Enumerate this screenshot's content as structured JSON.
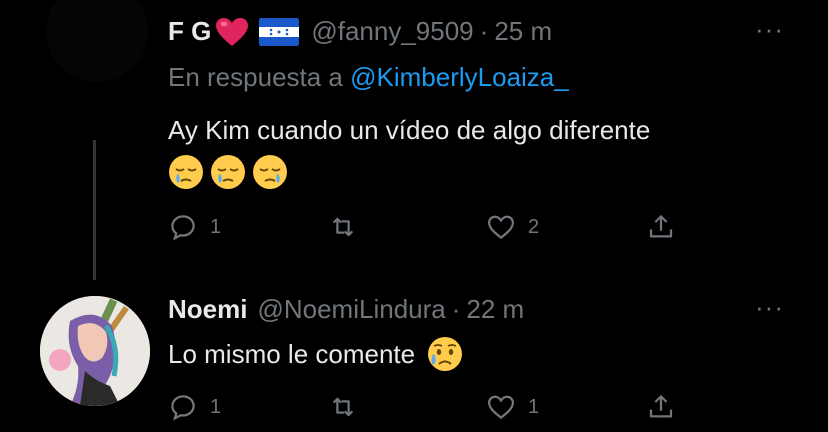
{
  "tweets": [
    {
      "name": "F G",
      "handle": "@fanny_9509",
      "time": "25 m",
      "reply_prefix": "En respuesta a",
      "reply_mention": "@KimberlyLoaiza_",
      "text": "Ay Kim cuando un vídeo de algo diferente",
      "emojis": [
        "sleepy-face-icon",
        "sleepy-face-icon",
        "sleepy-face-icon"
      ],
      "replies": "1",
      "retweets": "",
      "likes": "2"
    },
    {
      "name": "Noemi",
      "handle": "@NoemiLindura",
      "time": "22 m",
      "text": "Lo mismo le comente",
      "emojis": [
        "sad-relieved-face-icon"
      ],
      "replies": "1",
      "retweets": "",
      "likes": "1"
    }
  ],
  "more_label": "···",
  "separator": "·",
  "colors": {
    "background": "#000000",
    "text": "#e7e9ea",
    "muted": "#71767b",
    "link": "#1d9bf0",
    "heart": "#e0245e"
  }
}
